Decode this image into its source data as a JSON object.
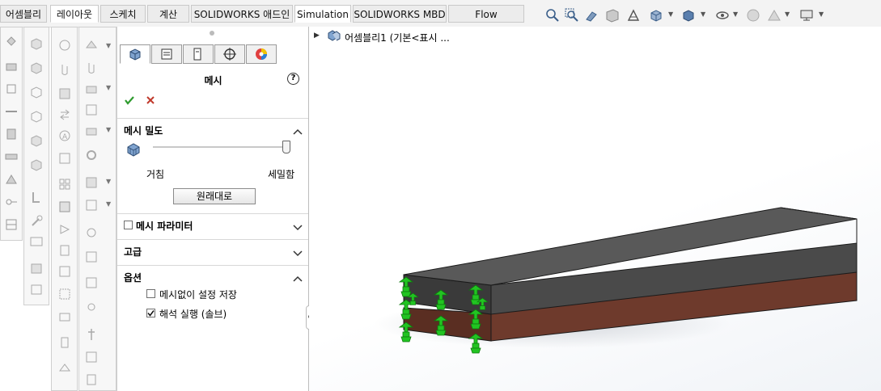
{
  "tabs": [
    {
      "label": "어셈블리",
      "active": false
    },
    {
      "label": "레이아웃",
      "active": true
    },
    {
      "label": "스케치",
      "active": false
    },
    {
      "label": "계산",
      "active": false
    },
    {
      "label": "SOLIDWORKS 애드인",
      "active": false
    },
    {
      "label": "Simulation",
      "active": true
    },
    {
      "label": "SOLIDWORKS MBD",
      "active": false
    },
    {
      "label": "Flow Simulation",
      "active": false
    }
  ],
  "feature_tree": {
    "root_label": "어셈블리1  (기본<표시 ..."
  },
  "mesh_panel": {
    "title": "메시",
    "help_icon": "help-icon",
    "ok_icon": "checkmark-icon",
    "cancel_icon": "x-icon",
    "density": {
      "title": "메시 밀도",
      "coarse_label": "거침",
      "fine_label": "세밀함",
      "slider_value": 1.0,
      "reset_label": "원래대로"
    },
    "parameters": {
      "title": "메시 파라미터",
      "checked": false
    },
    "advanced": {
      "title": "고급"
    },
    "options": {
      "title": "옵션",
      "save_without_mesh_label": "메시없이 설정 저장",
      "save_without_mesh_checked": false,
      "run_analysis_label": "해석 실행 (솔브)",
      "run_analysis_checked": true
    }
  },
  "colors": {
    "accept_green": "#2e9b2e",
    "cancel_red": "#c0392b",
    "top_slab": "#4a4a4a",
    "bottom_slab": "#6e3a2c",
    "fixture_green": "#22c422"
  }
}
